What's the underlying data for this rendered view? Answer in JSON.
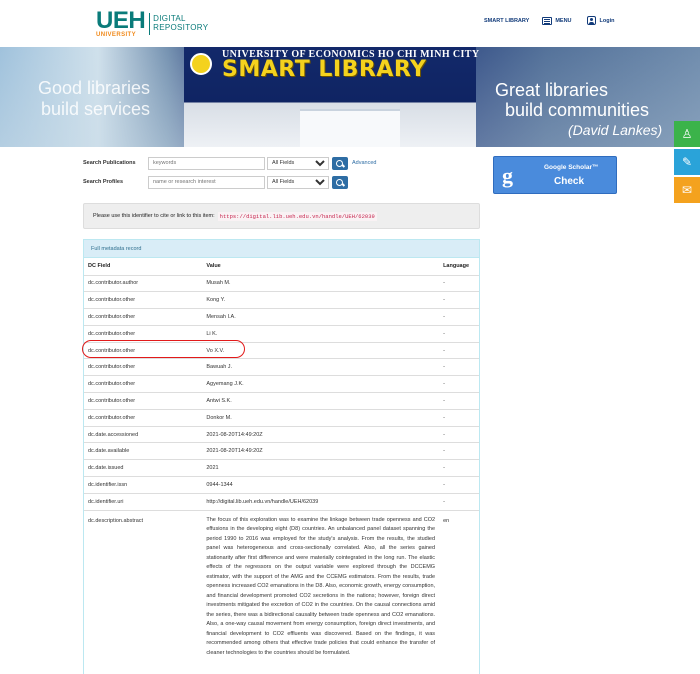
{
  "header": {
    "logo_main": "UEH",
    "logo_sub": "UNIVERSITY",
    "logo_line1": "DIGITAL",
    "logo_line2": "REPOSITORY",
    "nav_smart_library": "SMART LIBRARY",
    "nav_menu": "MENU",
    "nav_login": "Login"
  },
  "banner": {
    "university": "UNIVERSITY OF ECONOMICS HO CHI MINH CITY",
    "title": "SMART LIBRARY",
    "left_line1": "Good libraries",
    "left_line2": "build services",
    "right_line1": "Great libraries",
    "right_line2": "build communities",
    "right_line3": "(David Lankes)"
  },
  "search": {
    "publications_label": "Search Publications",
    "publications_placeholder": "keywords",
    "publications_field": "All Fields",
    "advanced_link": "Advanced",
    "profiles_label": "Search Profiles",
    "profiles_placeholder": "name or research interest",
    "profiles_field": "All Fields"
  },
  "google_scholar": {
    "title": "Google Scholar™",
    "action": "Check"
  },
  "identifier": {
    "text": "Please use this identifier to cite or link to this item:",
    "uri": "https://digital.lib.ueh.edu.vn/handle/UEH/62039"
  },
  "metadata": {
    "panel_title": "Full metadata record",
    "columns": [
      "DC Field",
      "Value",
      "Language"
    ],
    "rows": [
      {
        "field": "dc.contributor.author",
        "value": "Musah M.",
        "lang": "-"
      },
      {
        "field": "dc.contributor.other",
        "value": "Kong Y.",
        "lang": "-"
      },
      {
        "field": "dc.contributor.other",
        "value": "Mensah I.A.",
        "lang": "-"
      },
      {
        "field": "dc.contributor.other",
        "value": "Li K.",
        "lang": "-"
      },
      {
        "field": "dc.contributor.other",
        "value": "Vo X.V.",
        "lang": "-"
      },
      {
        "field": "dc.contributor.other",
        "value": "Bawuah J.",
        "lang": "-"
      },
      {
        "field": "dc.contributor.other",
        "value": "Agyemang J.K.",
        "lang": "-"
      },
      {
        "field": "dc.contributor.other",
        "value": "Antwi S.K.",
        "lang": "-"
      },
      {
        "field": "dc.contributor.other",
        "value": "Donkor M.",
        "lang": "-"
      },
      {
        "field": "dc.date.accessioned",
        "value": "2021-08-20T14:49:20Z",
        "lang": "-"
      },
      {
        "field": "dc.date.available",
        "value": "2021-08-20T14:49:20Z",
        "lang": "-"
      },
      {
        "field": "dc.date.issued",
        "value": "2021",
        "lang": "-"
      },
      {
        "field": "dc.identifier.issn",
        "value": "0944-1344",
        "lang": "-"
      },
      {
        "field": "dc.identifier.uri",
        "value": "http://digital.lib.ueh.edu.vn/handle/UEH/62039",
        "lang": "-"
      },
      {
        "field": "dc.description.abstract",
        "value": "The focus of this exploration was to examine the linkage between trade openness and CO2 effusions in the developing eight (D8) countries. An unbalanced panel dataset spanning the period 1990 to 2016 was employed for the study's analysis. From the results, the studied panel was heterogeneous and cross-sectionally correlated. Also, all the series gained stationarity after first difference and were materially cointegrated in the long run. The elastic effects of the regressors on the output variable were explored through the DCCEMG estimator, with the support of the AMG and the CCEMG estimators. From the results, trade openness increased CO2 emanations in the D8. Also, economic growth, energy consumption, and financial development promoted CO2 secretions in the nations; however, foreign direct investments mitigated the excretion of CO2 in the countries. On the causal connections amid the series, there was a bidirectional causality between trade openness and CO2 emanations. Also, a one-way causal movement from energy consumption, foreign direct investments, and financial development to CO2 effluents was discovered. Based on the findings, it was recommended among others that effective trade policies that could enhance the transfer of cleaner technologies to the countries should be formulated.",
        "lang": "en"
      }
    ]
  }
}
